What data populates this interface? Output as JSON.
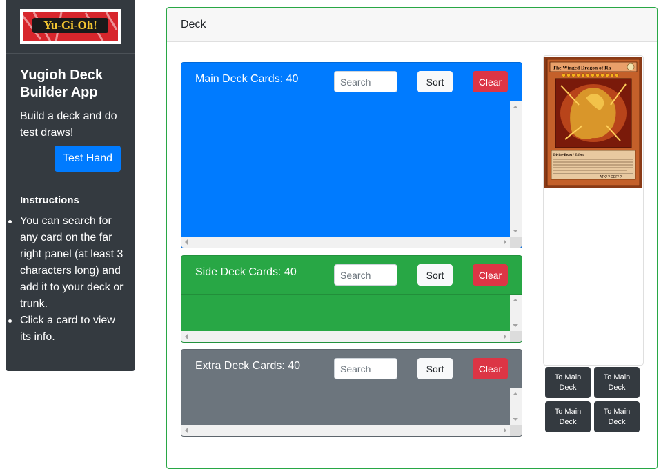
{
  "sidebar": {
    "logo_text": "Yu-Gi-Oh!",
    "title": "Yugioh Deck Builder App",
    "description": "Build a deck and do test draws!",
    "test_hand_label": "Test Hand",
    "instructions_title": "Instructions",
    "instructions": [
      "You can search for any card on the far right panel (at least 3 characters long) and add it to your deck or trunk.",
      "Click a card to view its info."
    ]
  },
  "deck": {
    "header": "Deck",
    "panels": [
      {
        "title": "Main Deck Cards: 40",
        "search_placeholder": "Search",
        "sort_label": "Sort",
        "clear_label": "Clear",
        "color": "#007bff"
      },
      {
        "title": "Side Deck Cards: 40",
        "search_placeholder": "Search",
        "sort_label": "Sort",
        "clear_label": "Clear",
        "color": "#28a745"
      },
      {
        "title": "Extra Deck Cards: 40",
        "search_placeholder": "Search",
        "sort_label": "Sort",
        "clear_label": "Clear",
        "color": "#6c757d"
      }
    ]
  },
  "preview": {
    "card_name": "The Winged Dragon of Ra",
    "card_type_line": "Divine-Beast / Effect",
    "atk_def": "ATK/ ? DEF/ ?",
    "buttons": [
      "To Main Deck",
      "To Main Deck",
      "To Main Deck",
      "To Main Deck"
    ]
  },
  "colors": {
    "sidebar_bg": "#343a40",
    "primary": "#007bff",
    "success": "#28a745",
    "secondary": "#6c757d",
    "danger": "#dc3545"
  }
}
